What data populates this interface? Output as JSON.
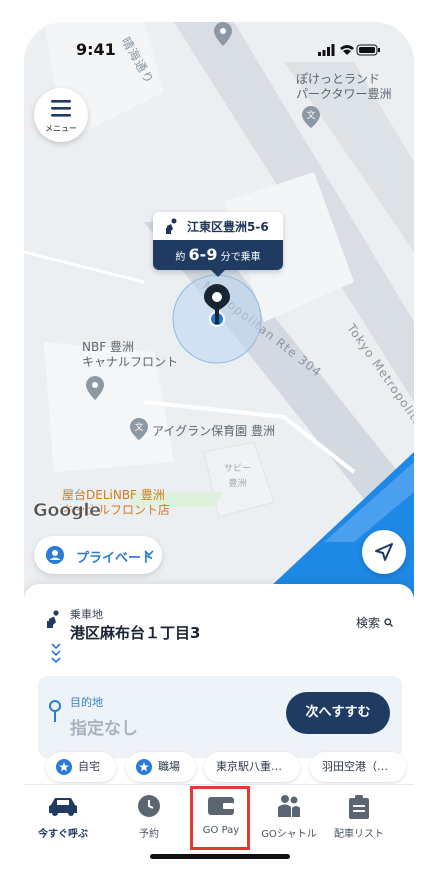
{
  "status": {
    "time": "9:41"
  },
  "map": {
    "streets": [
      "晴海通り",
      "Metropolitan Rte 304",
      "Tokyo Metropolitan"
    ],
    "places": [
      {
        "line1": "ぽけっとランド",
        "line2": "パークタワー豊洲"
      },
      {
        "line1": "NBF 豊洲",
        "line2": "キャナルフロント"
      },
      {
        "line1": "アイグラン保育園 豊洲",
        "line2": ""
      },
      {
        "line1": "屋台DELiNBF 豊洲",
        "line2": "キャナルフロント店"
      },
      {
        "line1": "サピー",
        "line2": "豊洲"
      }
    ],
    "google": "Google"
  },
  "menu": {
    "label": "メニュー"
  },
  "pin_bubble": {
    "address": "江東区豊洲5-6",
    "eta_prefix": "約",
    "eta_value": "6-9",
    "eta_suffix": "分で乗車"
  },
  "mode": {
    "label": "プライベート"
  },
  "pickup": {
    "label": "乗車地",
    "value": "港区麻布台１丁目3",
    "search": "検索"
  },
  "destination": {
    "label": "目的地",
    "value": "指定なし",
    "next": "次へすすむ"
  },
  "chips": [
    "自宅",
    "職場",
    "東京駅八重…",
    "羽田空港（…"
  ],
  "tabs": [
    "今すぐ呼ぶ",
    "予約",
    "GO Pay",
    "GOシャトル",
    "配車リスト"
  ],
  "colors": {
    "navy": "#1f3b62",
    "accent_blue": "#2a7bd5",
    "water": "#1e88e5",
    "highlight": "#e53935"
  }
}
